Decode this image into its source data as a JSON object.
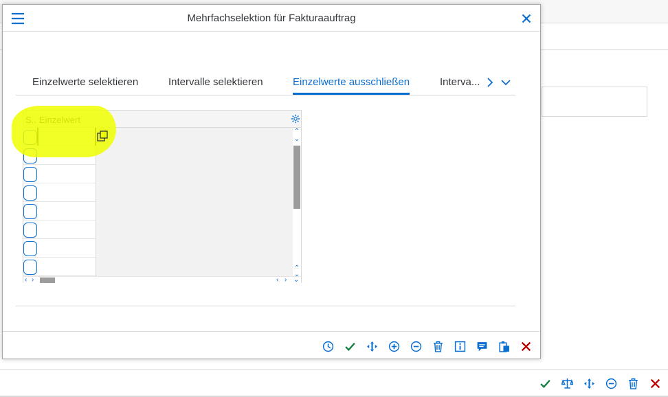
{
  "dialog": {
    "title": "Mehrfachselektion für Fakturaauftrag"
  },
  "tabs": [
    {
      "label": "Einzelwerte selektieren",
      "active": false
    },
    {
      "label": "Intervalle selektieren",
      "active": false
    },
    {
      "label": "Einzelwerte ausschließen",
      "active": true
    },
    {
      "label": "Interva...",
      "active": false
    }
  ],
  "table": {
    "columns": [
      "S..",
      "Einzelwert"
    ],
    "rows": [
      "",
      "",
      "",
      "",
      "",
      "",
      "",
      ""
    ]
  },
  "icons": {
    "dialog_footer": [
      "history-icon",
      "check-icon",
      "move-icon",
      "add-icon",
      "remove-icon",
      "delete-icon",
      "info-icon",
      "comment-icon",
      "paste-icon",
      "cancel-icon"
    ],
    "app_footer": [
      "check-icon",
      "scales-icon",
      "move-icon",
      "remove-icon",
      "delete-icon",
      "cancel-icon"
    ]
  },
  "colors": {
    "accent": "#0a6ed1",
    "confirm": "#107e3e",
    "cancel": "#bb0000",
    "highlight": "#f0ff00"
  }
}
